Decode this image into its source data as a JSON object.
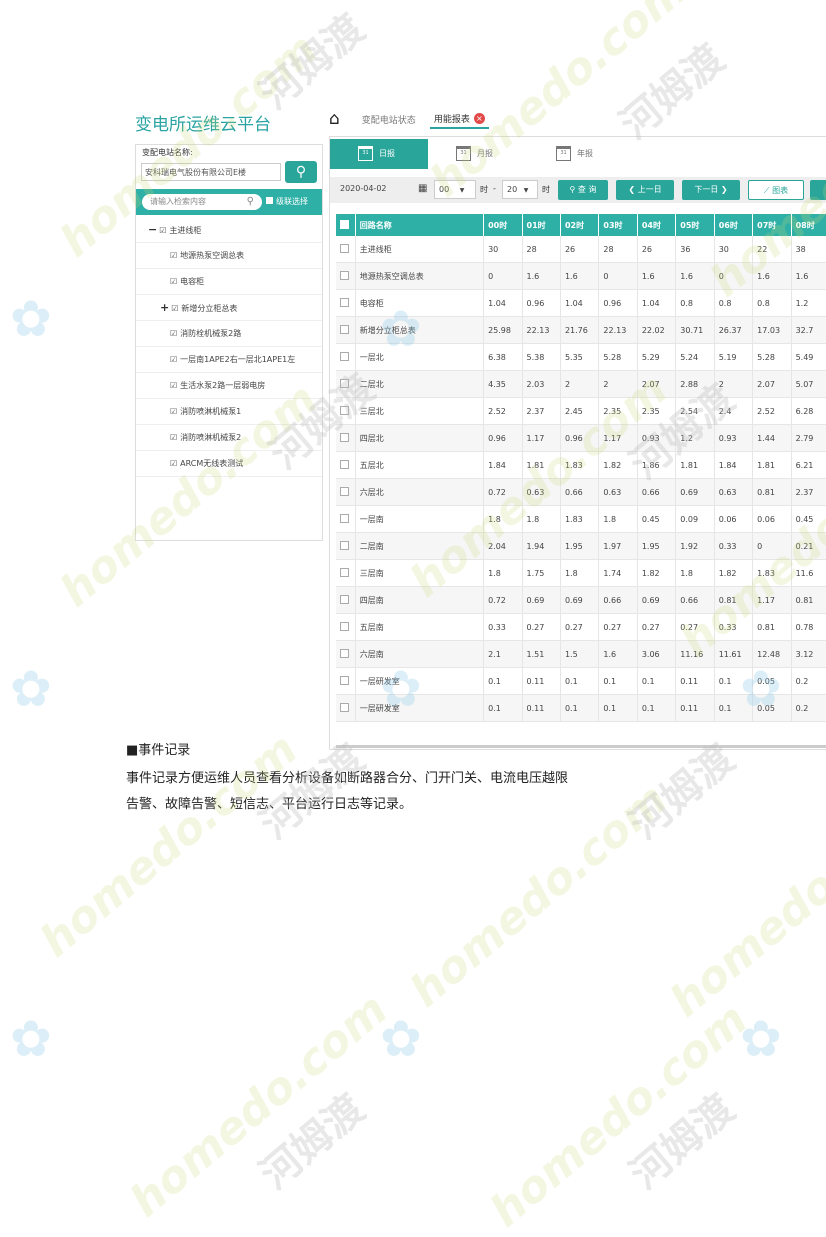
{
  "app": {
    "brand": "变电所运维云平台",
    "nav_tabs": [
      "变配电站状态",
      "用能报表"
    ]
  },
  "left_panel": {
    "station_label": "变配电站名称:",
    "station_value": "安科瑞电气股份有限公司E楼",
    "tree_search_placeholder": "请输入检索内容",
    "cascade_label": "级联选择",
    "tree": [
      {
        "toggle": "−",
        "label": "主进线柜",
        "level": 1
      },
      {
        "label": "地源热泵空调总表",
        "level": 2
      },
      {
        "label": "电容柜",
        "level": 2
      },
      {
        "toggle": "+",
        "label": "新增分立柜总表",
        "level": 2
      },
      {
        "label": "消防栓机械泵2路",
        "level": 2
      },
      {
        "label": "一层南1APE2右一层北1APE1左",
        "level": 2
      },
      {
        "label": "生活水泵2路一层弱电房",
        "level": 2
      },
      {
        "label": "消防喷淋机械泵1",
        "level": 2
      },
      {
        "label": "消防喷淋机械泵2",
        "level": 2
      },
      {
        "label": "ARCM无线表测试",
        "level": 2
      }
    ]
  },
  "report": {
    "tabs": [
      "日报",
      "月报",
      "年报"
    ],
    "date": "2020-04-02",
    "hour_from": "00",
    "hour_to": "20",
    "hour_unit": "时",
    "dash": "-",
    "query_label": "查 询",
    "prev_label": "上一日",
    "next_label": "下一日",
    "chart_label": "图表",
    "columns": [
      "回路名称",
      "00时",
      "01时",
      "02时",
      "03时",
      "04时",
      "05时",
      "06时",
      "07时",
      "08时"
    ],
    "rows": [
      [
        "主进线柜",
        "30",
        "28",
        "26",
        "28",
        "26",
        "36",
        "30",
        "22",
        "38"
      ],
      [
        "地源热泵空调总表",
        "0",
        "1.6",
        "1.6",
        "0",
        "1.6",
        "1.6",
        "0",
        "1.6",
        "1.6"
      ],
      [
        "电容柜",
        "1.04",
        "0.96",
        "1.04",
        "0.96",
        "1.04",
        "0.8",
        "0.8",
        "0.8",
        "1.2"
      ],
      [
        "新增分立柜总表",
        "25.98",
        "22.13",
        "21.76",
        "22.13",
        "22.02",
        "30.71",
        "26.37",
        "17.03",
        "32.7"
      ],
      [
        "一层北",
        "6.38",
        "5.38",
        "5.35",
        "5.28",
        "5.29",
        "5.24",
        "5.19",
        "5.28",
        "5.49"
      ],
      [
        "二层北",
        "4.35",
        "2.03",
        "2",
        "2",
        "2.07",
        "2.88",
        "2",
        "2.07",
        "5.07"
      ],
      [
        "三层北",
        "2.52",
        "2.37",
        "2.45",
        "2.35",
        "2.35",
        "2.54",
        "2.4",
        "2.52",
        "6.28"
      ],
      [
        "四层北",
        "0.96",
        "1.17",
        "0.96",
        "1.17",
        "0.93",
        "1.2",
        "0.93",
        "1.44",
        "2.79"
      ],
      [
        "五层北",
        "1.84",
        "1.81",
        "1.83",
        "1.82",
        "1.86",
        "1.81",
        "1.84",
        "1.81",
        "6.21"
      ],
      [
        "六层北",
        "0.72",
        "0.63",
        "0.66",
        "0.63",
        "0.66",
        "0.69",
        "0.63",
        "0.81",
        "2.37"
      ],
      [
        "一层南",
        "1.8",
        "1.8",
        "1.83",
        "1.8",
        "0.45",
        "0.09",
        "0.06",
        "0.06",
        "0.45"
      ],
      [
        "二层南",
        "2.04",
        "1.94",
        "1.95",
        "1.97",
        "1.95",
        "1.92",
        "0.33",
        "0",
        "0.21"
      ],
      [
        "三层南",
        "1.8",
        "1.75",
        "1.8",
        "1.74",
        "1.82",
        "1.8",
        "1.82",
        "1.83",
        "11.6"
      ],
      [
        "四层南",
        "0.72",
        "0.69",
        "0.69",
        "0.66",
        "0.69",
        "0.66",
        "0.81",
        "1.17",
        "0.81"
      ],
      [
        "五层南",
        "0.33",
        "0.27",
        "0.27",
        "0.27",
        "0.27",
        "0.27",
        "0.33",
        "0.81",
        "0.78"
      ],
      [
        "六层南",
        "2.1",
        "1.51",
        "1.5",
        "1.6",
        "3.06",
        "11.16",
        "11.61",
        "12.48",
        "3.12"
      ],
      [
        "一层研发室",
        "0.1",
        "0.11",
        "0.1",
        "0.1",
        "0.1",
        "0.11",
        "0.1",
        "0.05",
        "0.2"
      ],
      [
        "一层研发室",
        "0.1",
        "0.11",
        "0.1",
        "0.1",
        "0.1",
        "0.11",
        "0.1",
        "0.05",
        "0.2"
      ]
    ]
  },
  "doc": {
    "section_title": "■事件记录",
    "para_line1": "事件记录方便运维人员查看分析设备如断路器合分、门开门关、电流电压越限",
    "para_line2": "告警、故障告警、短信志、平台运行日志等记录。"
  },
  "watermarks": {
    "en": "homedo.com",
    "cn": "河姆渡"
  }
}
